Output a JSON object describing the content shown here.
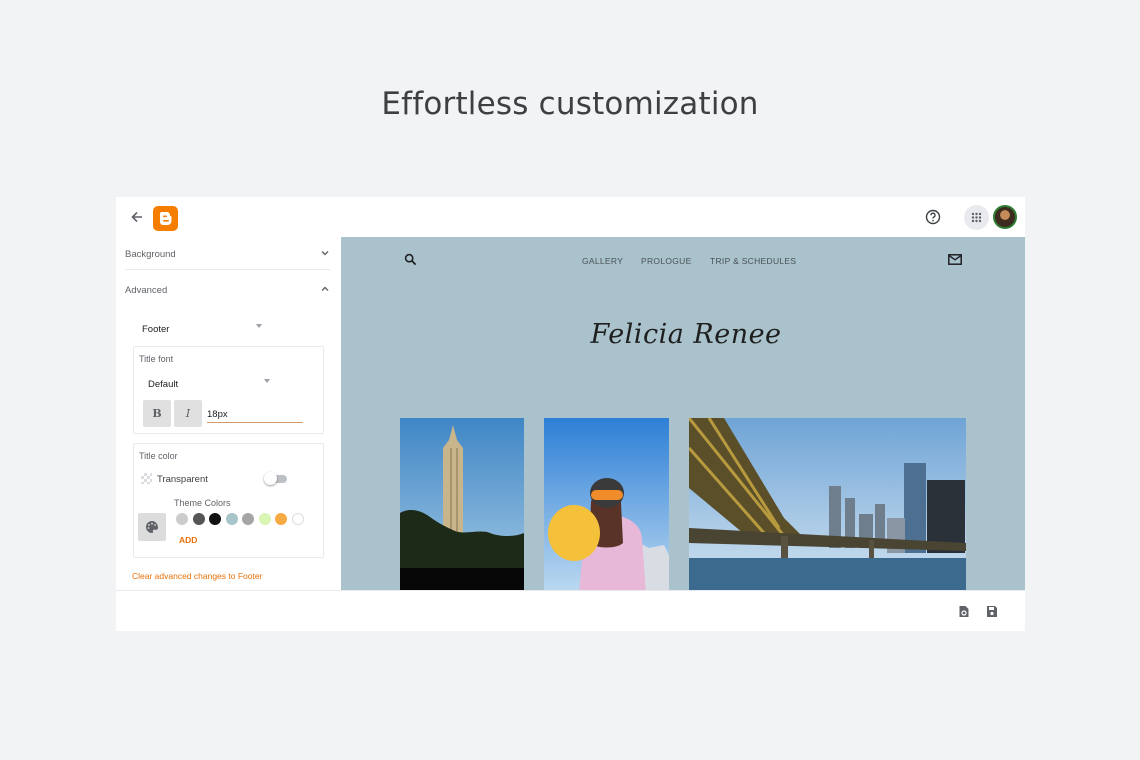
{
  "headline": "Effortless customization",
  "topbar": {
    "back_icon": "arrow-back-icon",
    "logo_icon": "blogger-logo-icon",
    "help_icon": "help-circle-icon",
    "apps_icon": "apps-grid-icon",
    "avatar_icon": "user-avatar"
  },
  "panel": {
    "background_label": "Background",
    "advanced_label": "Advanced",
    "section_select": "Footer",
    "title_font": {
      "label": "Title font",
      "font_value": "Default",
      "bold_label": "B",
      "italic_label": "I",
      "size_value": "18px"
    },
    "title_color": {
      "label": "Title color",
      "transparent_label": "Transparent",
      "transparent_on": false,
      "theme_colors_label": "Theme Colors",
      "swatches": [
        "#cccccc",
        "#555555",
        "#111111",
        "#a6c4ca",
        "#a5a5a5",
        "#d9f5b3",
        "#f7a944",
        "#ffffff"
      ],
      "add_label": "ADD"
    },
    "clear_link": "Clear advanced changes to Footer"
  },
  "preview": {
    "nav": [
      "GALLERY",
      "PROLOGUE",
      "TRIP & SCHEDULES"
    ],
    "site_title": "Felicia Renee",
    "background_color": "#a9c2cb"
  },
  "bottombar": {
    "preview_icon": "preview-icon",
    "save_icon": "save-icon"
  },
  "colors": {
    "accent": "#e8710a",
    "brand": "#f57d00"
  }
}
